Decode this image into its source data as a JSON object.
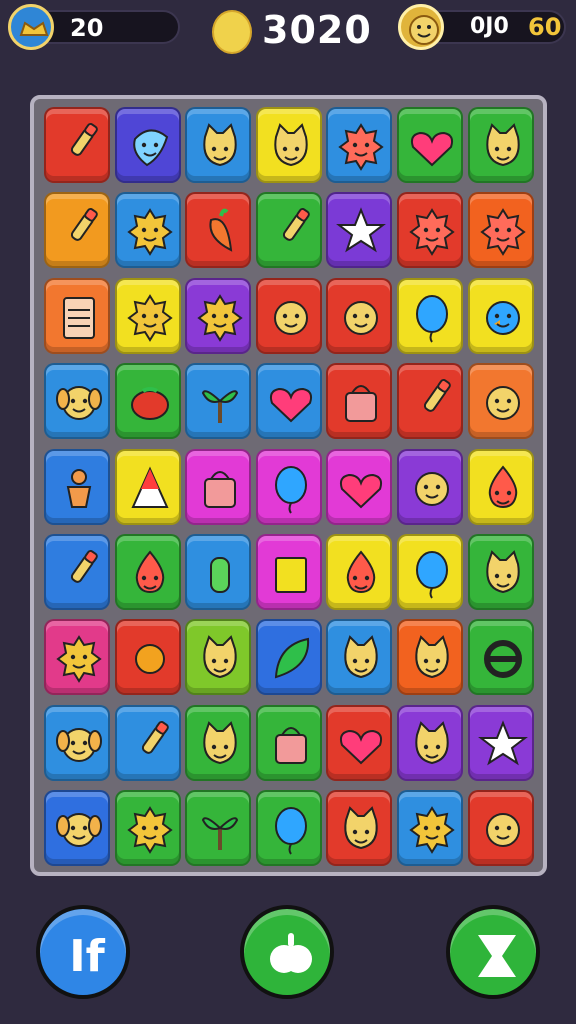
{
  "hud": {
    "level": "20",
    "score": "3020",
    "moves": "0J0",
    "target": "60"
  },
  "board": {
    "rows": [
      [
        {
          "color": "#e23a2b",
          "icon": "brush-icon"
        },
        {
          "color": "#4f46d6",
          "icon": "blob-icon"
        },
        {
          "color": "#2f8fe0",
          "icon": "cat-face-icon"
        },
        {
          "color": "#f2e020",
          "icon": "cat-face-icon"
        },
        {
          "color": "#2f8fe0",
          "icon": "spiky-face-icon"
        },
        {
          "color": "#35b53a",
          "icon": "heart-icon"
        },
        {
          "color": "#35b53a",
          "icon": "cat-face-icon"
        }
      ],
      [
        {
          "color": "#f29a1f",
          "icon": "brush-icon"
        },
        {
          "color": "#2f8fe0",
          "icon": "sun-face-icon"
        },
        {
          "color": "#e23a2b",
          "icon": "carrot-icon"
        },
        {
          "color": "#35b53a",
          "icon": "brush-icon"
        },
        {
          "color": "#7b3ad6",
          "icon": "star-icon"
        },
        {
          "color": "#e23a2b",
          "icon": "spiky-face-icon"
        },
        {
          "color": "#f2621f",
          "icon": "spiky-face-icon"
        }
      ],
      [
        {
          "color": "#f2772f",
          "icon": "card-icon"
        },
        {
          "color": "#f2e020",
          "icon": "sun-face-icon"
        },
        {
          "color": "#8a3ad6",
          "icon": "sun-face-icon"
        },
        {
          "color": "#e23a2b",
          "icon": "face-icon"
        },
        {
          "color": "#e23a2b",
          "icon": "face-icon"
        },
        {
          "color": "#f2e020",
          "icon": "balloon-icon"
        },
        {
          "color": "#f2e020",
          "icon": "bird-icon"
        }
      ],
      [
        {
          "color": "#2f8fe0",
          "icon": "dog-face-icon"
        },
        {
          "color": "#35b53a",
          "icon": "tomato-icon"
        },
        {
          "color": "#2f8fe0",
          "icon": "plant-icon"
        },
        {
          "color": "#2f8fe0",
          "icon": "heart-icon"
        },
        {
          "color": "#e23a2b",
          "icon": "bag-icon"
        },
        {
          "color": "#e23a2b",
          "icon": "brush-icon"
        },
        {
          "color": "#f2772f",
          "icon": "face-icon"
        }
      ],
      [
        {
          "color": "#2f7de0",
          "icon": "gingerbread-icon"
        },
        {
          "color": "#f2e020",
          "icon": "cone-icon"
        },
        {
          "color": "#e23ad6",
          "icon": "bag-icon"
        },
        {
          "color": "#e23ad6",
          "icon": "balloon-icon"
        },
        {
          "color": "#e23ad6",
          "icon": "heart-icon"
        },
        {
          "color": "#8a3ad6",
          "icon": "face-icon"
        },
        {
          "color": "#f2e020",
          "icon": "drop-face-icon"
        }
      ],
      [
        {
          "color": "#2f7de0",
          "icon": "brush-icon"
        },
        {
          "color": "#35b53a",
          "icon": "drop-face-icon"
        },
        {
          "color": "#2f8fe0",
          "icon": "cactus-icon"
        },
        {
          "color": "#e23ad6",
          "icon": "square-icon"
        },
        {
          "color": "#f2e020",
          "icon": "drop-face-icon"
        },
        {
          "color": "#f2e020",
          "icon": "balloon-icon"
        },
        {
          "color": "#35b53a",
          "icon": "cat-face-icon"
        }
      ],
      [
        {
          "color": "#e23a8a",
          "icon": "sun-face-icon"
        },
        {
          "color": "#e23a2b",
          "icon": "sun-icon"
        },
        {
          "color": "#7fc82a",
          "icon": "cat-face-icon"
        },
        {
          "color": "#2f6fe0",
          "icon": "leaf-icon"
        },
        {
          "color": "#2f8fe0",
          "icon": "cat-face-icon"
        },
        {
          "color": "#f2621f",
          "icon": "cat-face-icon"
        },
        {
          "color": "#35b53a",
          "icon": "ring-icon"
        }
      ],
      [
        {
          "color": "#2f8fe0",
          "icon": "dog-face-icon"
        },
        {
          "color": "#2f8fe0",
          "icon": "brush-icon"
        },
        {
          "color": "#35b53a",
          "icon": "cat-face-icon"
        },
        {
          "color": "#35b53a",
          "icon": "bag-icon"
        },
        {
          "color": "#e23a2b",
          "icon": "heart-icon"
        },
        {
          "color": "#8a3ad6",
          "icon": "cat-face-icon"
        },
        {
          "color": "#8a3ad6",
          "icon": "star-icon"
        }
      ],
      [
        {
          "color": "#2f6fe0",
          "icon": "dog-face-icon"
        },
        {
          "color": "#35b53a",
          "icon": "sun-face-icon"
        },
        {
          "color": "#35b53a",
          "icon": "plant-icon"
        },
        {
          "color": "#35b53a",
          "icon": "balloon-icon"
        },
        {
          "color": "#e23a2b",
          "icon": "cat-face-icon"
        },
        {
          "color": "#2f8fe0",
          "icon": "sun-face-icon"
        },
        {
          "color": "#e23a2b",
          "icon": "face-icon"
        }
      ]
    ]
  },
  "controls": {
    "left_icon": "shuffle-icon",
    "middle_icon": "apple-icon",
    "right_icon": "hourglass-icon"
  }
}
